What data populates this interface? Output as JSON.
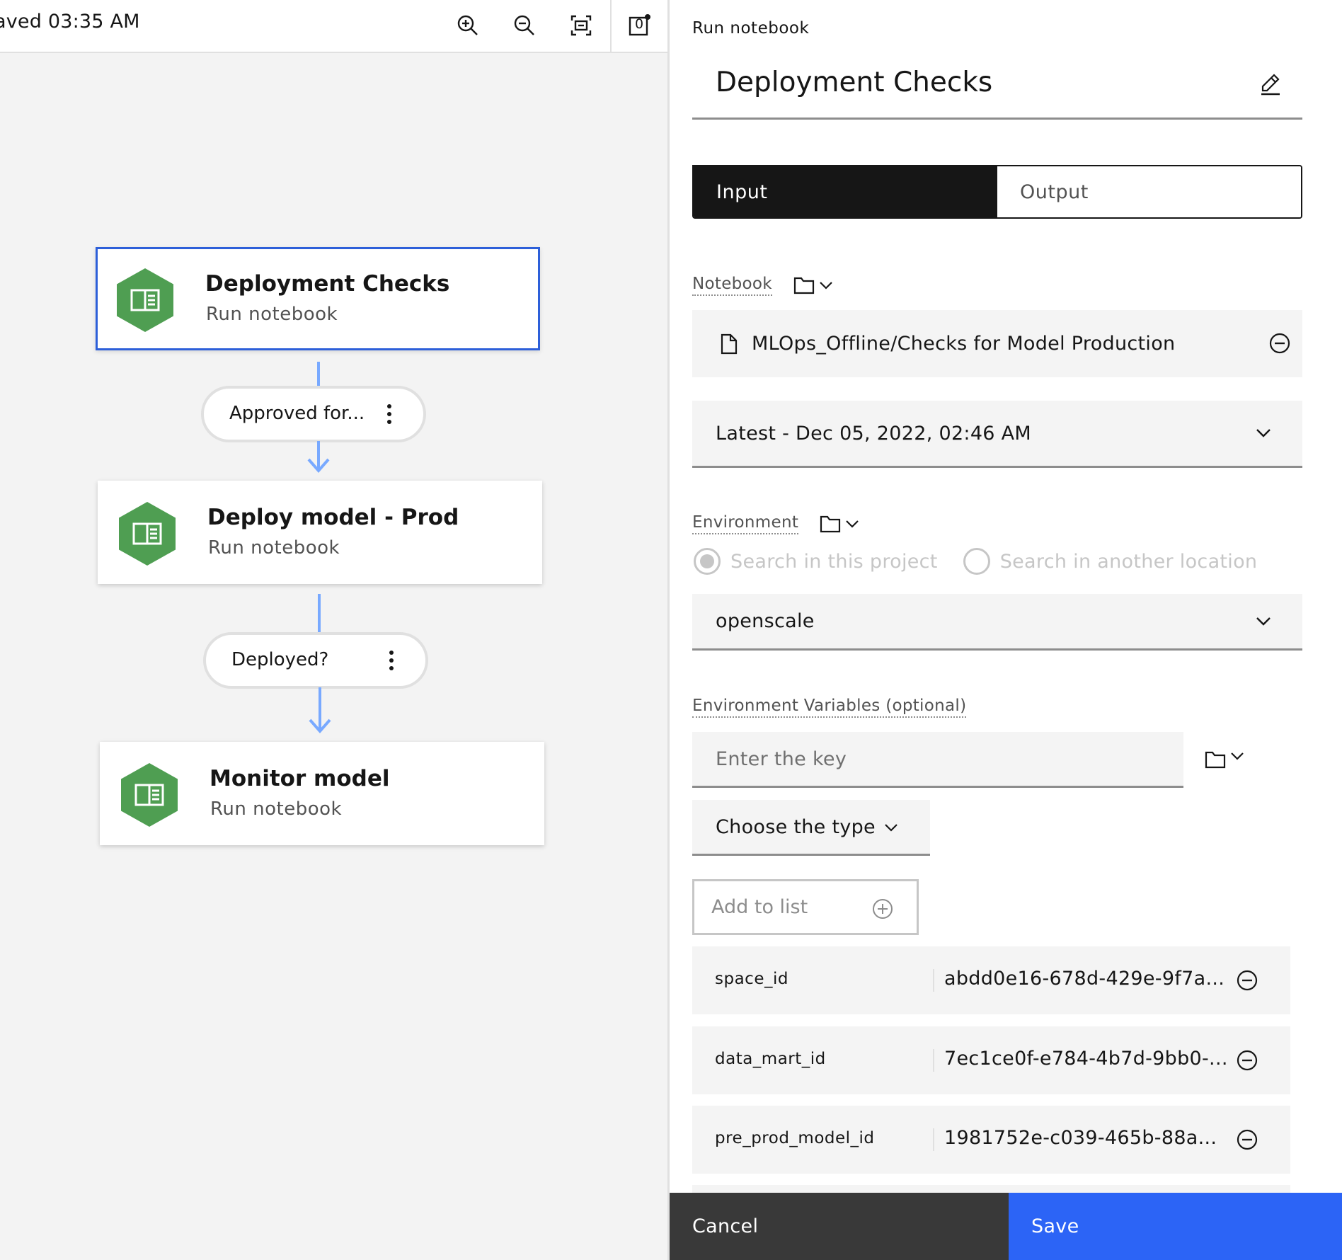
{
  "toolbar": {
    "saved_status": "aved 03:35 AM",
    "zoom_in_icon": "zoom-in-icon",
    "zoom_out_icon": "zoom-out-icon",
    "fit_icon": "fit-to-screen-icon",
    "notification_count": "0"
  },
  "canvas": {
    "nodes": [
      {
        "title": "Deployment Checks",
        "subtitle": "Run notebook",
        "selected": true,
        "icon": "notebook-icon",
        "color": "#4f9e52"
      },
      {
        "title": "Deploy model - Prod",
        "subtitle": "Run notebook",
        "selected": false,
        "icon": "notebook-icon",
        "color": "#4f9e52"
      },
      {
        "title": "Monitor model",
        "subtitle": "Run notebook",
        "selected": false,
        "icon": "notebook-icon",
        "color": "#4f9e52"
      }
    ],
    "conditions": [
      {
        "label": "Approved for..."
      },
      {
        "label": "Deployed?"
      }
    ],
    "edge_color": "#78a9ff",
    "selection_color": "#2d5fd9"
  },
  "panel": {
    "node_type": "Run notebook",
    "title": "Deployment Checks",
    "tabs": [
      {
        "label": "Input",
        "active": true
      },
      {
        "label": "Output",
        "active": false
      }
    ],
    "notebook": {
      "label": "Notebook",
      "path": "MLOps_Offline/Checks for Model Production",
      "version": "Latest - Dec 05, 2022, 02:46 AM"
    },
    "environment": {
      "label": "Environment",
      "radio_options": [
        {
          "label": "Search in this project",
          "checked": true,
          "disabled": true
        },
        {
          "label": "Search in another location",
          "checked": false,
          "disabled": true
        }
      ],
      "selected": "openscale"
    },
    "env_vars": {
      "label": "Environment Variables (optional)",
      "key_placeholder": "Enter the key",
      "type_placeholder": "Choose the type",
      "add_label": "Add to list",
      "items": [
        {
          "key": "space_id",
          "value": "abdd0e16-678d-429e-9f7a..."
        },
        {
          "key": "data_mart_id",
          "value": "7ec1ce0f-e784-4b7d-9bb0-..."
        },
        {
          "key": "pre_prod_model_id",
          "value": "1981752e-c039-465b-88a..."
        }
      ]
    }
  },
  "footer": {
    "cancel_label": "Cancel",
    "save_label": "Save",
    "save_color": "#2c64f6"
  }
}
